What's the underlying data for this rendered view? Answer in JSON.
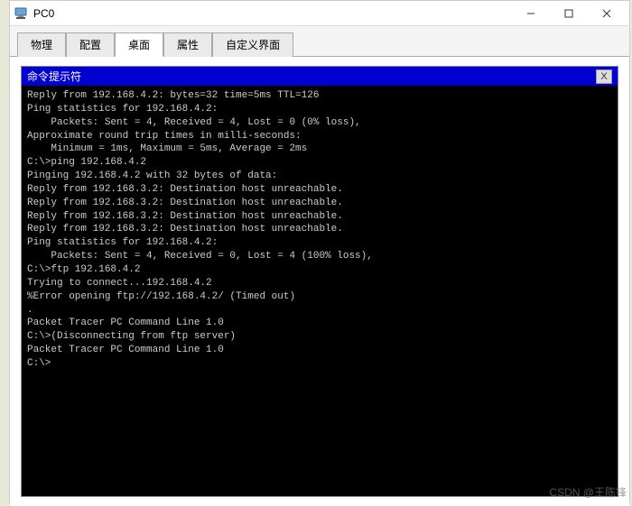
{
  "window": {
    "title": "PC0"
  },
  "tabs": [
    {
      "label": "物理"
    },
    {
      "label": "配置"
    },
    {
      "label": "桌面"
    },
    {
      "label": "属性"
    },
    {
      "label": "自定义界面"
    }
  ],
  "active_tab": 2,
  "subwindow": {
    "title": "命令提示符",
    "close": "X"
  },
  "terminal_lines": [
    "Reply from 192.168.4.2: bytes=32 time=5ms TTL=126",
    "",
    "Ping statistics for 192.168.4.2:",
    "    Packets: Sent = 4, Received = 4, Lost = 0 (0% loss),",
    "Approximate round trip times in milli-seconds:",
    "    Minimum = 1ms, Maximum = 5ms, Average = 2ms",
    "",
    "C:\\>ping 192.168.4.2",
    "",
    "Pinging 192.168.4.2 with 32 bytes of data:",
    "",
    "Reply from 192.168.3.2: Destination host unreachable.",
    "Reply from 192.168.3.2: Destination host unreachable.",
    "Reply from 192.168.3.2: Destination host unreachable.",
    "Reply from 192.168.3.2: Destination host unreachable.",
    "",
    "Ping statistics for 192.168.4.2:",
    "    Packets: Sent = 4, Received = 0, Lost = 4 (100% loss),",
    "",
    "C:\\>ftp 192.168.4.2",
    "Trying to connect...192.168.4.2",
    "",
    "%Error opening ftp://192.168.4.2/ (Timed out)",
    ".",
    "",
    "",
    "",
    "Packet Tracer PC Command Line 1.0",
    "C:\\>(Disconnecting from ftp server)",
    "",
    "",
    "",
    "Packet Tracer PC Command Line 1.0",
    "C:\\>"
  ],
  "watermark": "CSDN @王陈锋"
}
